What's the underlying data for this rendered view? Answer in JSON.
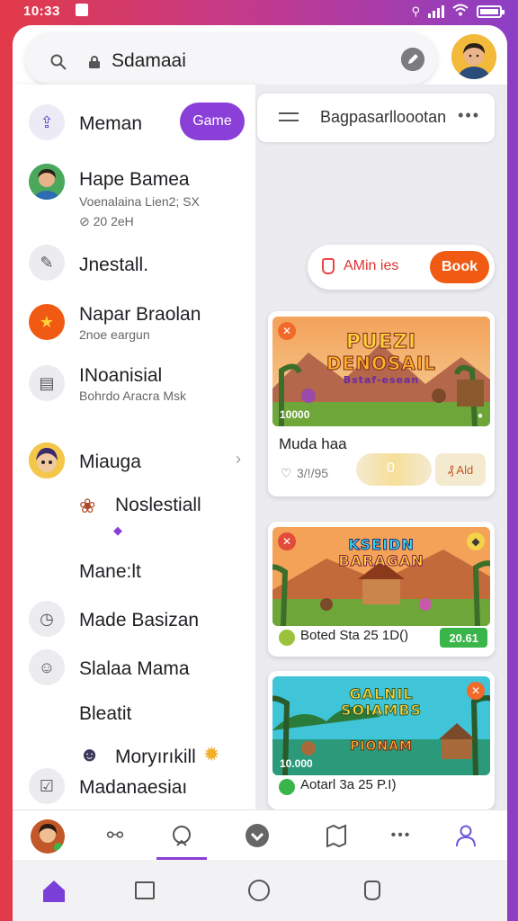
{
  "status": {
    "time": "10:33"
  },
  "search": {
    "value": "Sdamaai"
  },
  "drawer": {
    "game_pill": "Game",
    "items": [
      {
        "title": "Meman"
      },
      {
        "title": "Hape Bamea",
        "sub1": "Voenalaina Lien2; SX",
        "sub2": "⊘ 20 2eH"
      },
      {
        "title": "Jnestall."
      },
      {
        "title": "Napar Braolan",
        "sub1": "2noe eargun"
      },
      {
        "title": "INoanisial",
        "sub1": "Bohrdo Aracra Msk"
      },
      {
        "title": "Miauga"
      },
      {
        "title": "Noslestiall"
      },
      {
        "title": "Mane:lt"
      },
      {
        "title": "Made Basizan"
      },
      {
        "title": "Slalaa Mama"
      },
      {
        "title": "Bleatit"
      },
      {
        "title": "Moryırıkill"
      },
      {
        "title": "Madanaesiaı"
      }
    ]
  },
  "content": {
    "tab_title": "Bagpasarlloootan",
    "action_label": "AMin ies",
    "book_button": "Book",
    "cards": [
      {
        "art_title_1": "PUEZI",
        "art_title_2": "DENOSAIL",
        "art_subtitle": "Bstaf-esean",
        "score_overlay": "10000",
        "caption": "Muda haa",
        "meta_left": "3/!/95",
        "meta_center": "0",
        "meta_right": "₰ Ald"
      },
      {
        "art_title_1": "KSEIDN",
        "art_title_2": "BARAGAN",
        "caption": "Boted Sta 25 1D()",
        "badge": "20.61"
      },
      {
        "art_title_1": "GALNIL",
        "art_title_2": "SOIAMBS",
        "art_title_3": "PIONAM",
        "score_overlay": "10.000",
        "caption": "Aotarl 3a 25 P.I)"
      }
    ]
  },
  "colors": {
    "accent": "#8a3fd8",
    "book": "#f05a12",
    "badge_green": "#3ab54a"
  }
}
